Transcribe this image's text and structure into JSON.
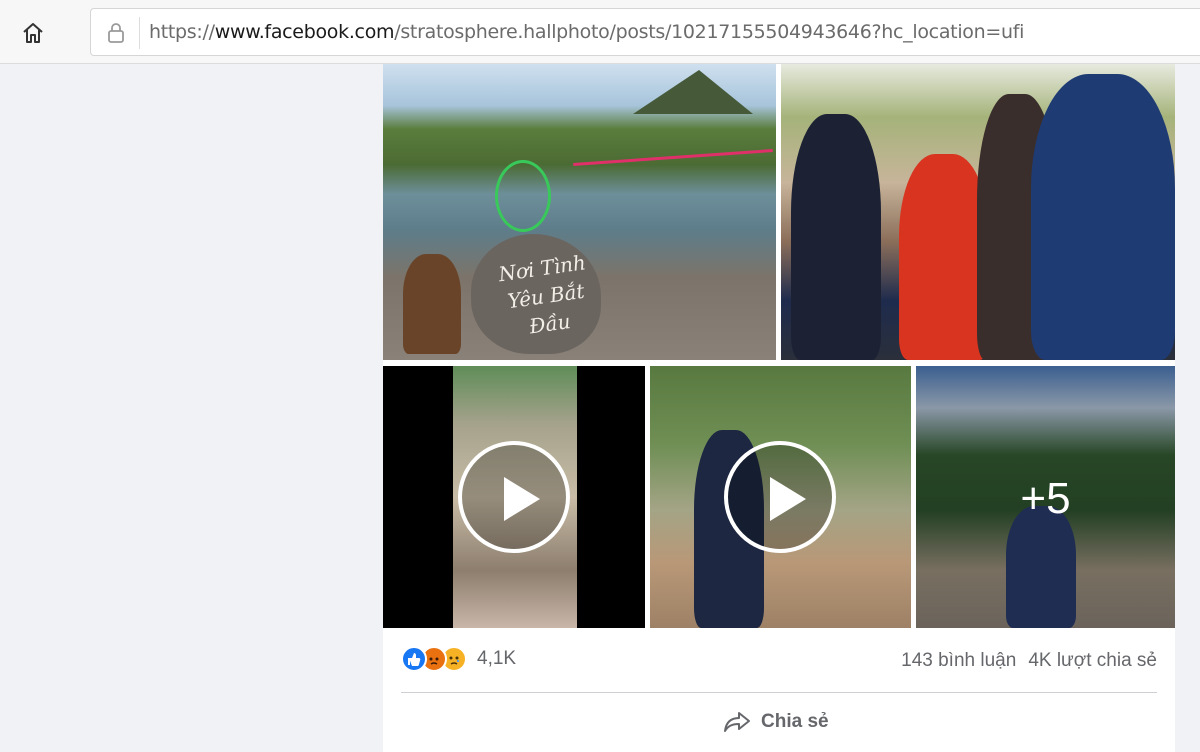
{
  "browser": {
    "url_prefix": "https://",
    "url_host": "www.facebook.com",
    "url_path": "/stratosphere.hallphoto/posts/10217155504943646?hc_location=ufi",
    "icons": [
      "home-icon",
      "lock-icon"
    ]
  },
  "post": {
    "photo_text": "Nơi Tình Yêu Bắt Đầu",
    "more_photos": "+5",
    "reactions": {
      "types": [
        "like",
        "angry",
        "sad"
      ],
      "count": "4,1K"
    },
    "comments": "143 bình luận",
    "shares": "4K lượt chia sẻ",
    "share_label": "Chia sẻ"
  },
  "colors": {
    "like": "#1877f2",
    "angry": "#e9710f",
    "sad": "#f7b125",
    "meta_text": "#65676b"
  }
}
